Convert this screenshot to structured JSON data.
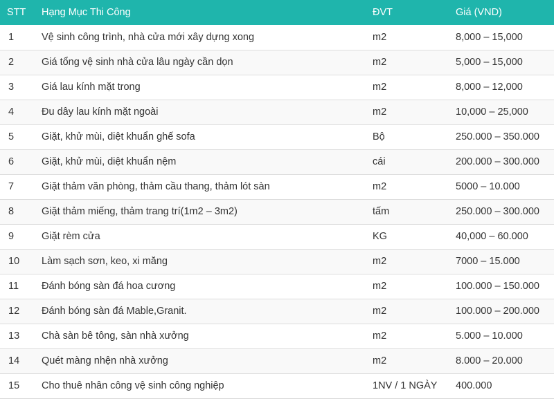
{
  "table": {
    "headers": [
      "STT",
      "Hạng Mục Thi Công",
      "ĐVT",
      "Giá (VND)"
    ],
    "rows": [
      [
        "1",
        "Vệ sinh công trình, nhà cửa mới xây dựng xong",
        "m2",
        "8,000 – 15,000"
      ],
      [
        "2",
        "Giá tổng vệ sinh nhà cửa lâu ngày cần dọn",
        "m2",
        "5,000 – 15,000"
      ],
      [
        "3",
        "Giá lau kính mặt trong",
        "m2",
        "8,000 – 12,000"
      ],
      [
        "4",
        "Đu dây lau kính mặt ngoài",
        "m2",
        "10,000 – 25,000"
      ],
      [
        "5",
        "Giặt, khử mùi, diệt khuẩn ghế sofa",
        "Bộ",
        "250.000 – 350.000"
      ],
      [
        "6",
        "Giặt, khử mùi, diệt khuẩn nệm",
        "cái",
        "200.000 – 300.000"
      ],
      [
        "7",
        "Giặt thảm văn phòng, thảm cầu thang, thảm lót sàn",
        "m2",
        "5000 – 10.000"
      ],
      [
        "8",
        "Giặt thảm miếng, thảm trang trí(1m2 – 3m2)",
        "tấm",
        "250.000 – 300.000"
      ],
      [
        "9",
        "Giặt rèm cửa",
        "KG",
        "40,000 – 60.000"
      ],
      [
        "10",
        "Làm sạch sơn, keo, xi măng",
        "m2",
        "7000 – 15.000"
      ],
      [
        "11",
        "Đánh bóng sàn đá hoa cương",
        "m2",
        "100.000 – 150.000"
      ],
      [
        "12",
        "Đánh bóng sàn đá Mable,Granit.",
        "m2",
        "100.000 – 200.000"
      ],
      [
        "13",
        "Chà sàn bê tông, sàn nhà xưởng",
        "m2",
        "5.000 – 10.000"
      ],
      [
        "14",
        "Quét màng nhện nhà xưởng",
        "m2",
        "8.000 – 20.000"
      ],
      [
        "15",
        "Cho thuê nhân công vệ sinh công nghiệp",
        "1NV / 1 NGÀY",
        "400.000"
      ]
    ]
  },
  "colors": {
    "header_bg": "#1fb5ac",
    "header_text": "#ffffff",
    "row_border": "#dcdcdc"
  }
}
